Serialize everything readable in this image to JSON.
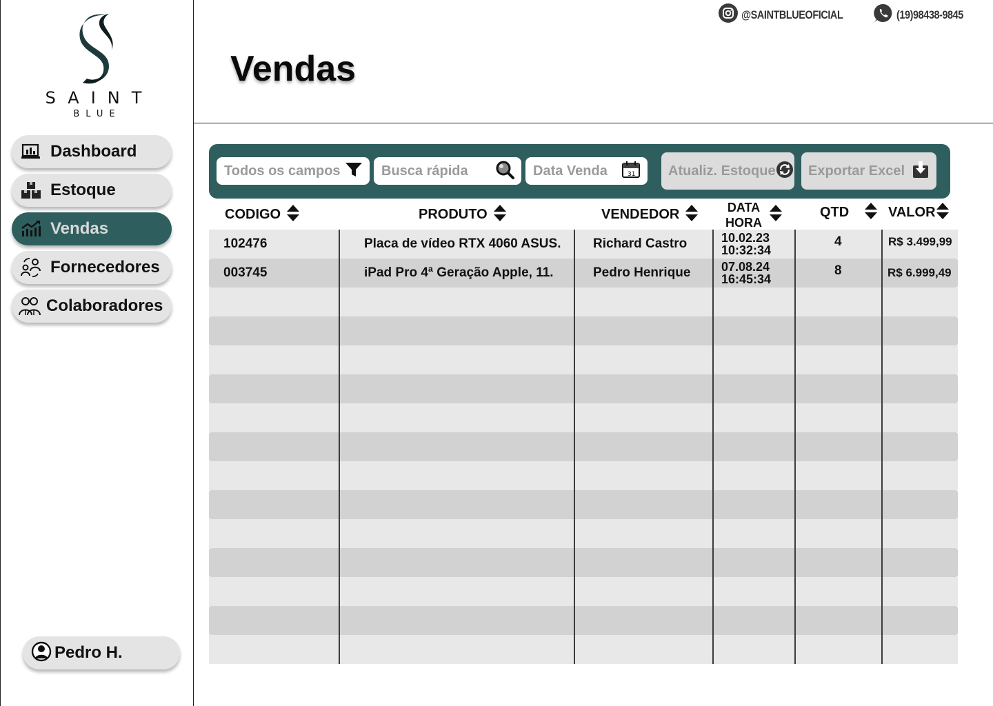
{
  "brand": {
    "name": "SAINT",
    "sub": "BLUE"
  },
  "nav": [
    {
      "label": "Dashboard",
      "icon": "dashboard-icon",
      "active": false
    },
    {
      "label": "Estoque",
      "icon": "boxes-icon",
      "active": false
    },
    {
      "label": "Vendas",
      "icon": "sales-chart-icon",
      "active": true
    },
    {
      "label": "Fornecedores",
      "icon": "suppliers-icon",
      "active": false
    },
    {
      "label": "Colaboradores",
      "icon": "team-icon",
      "active": false
    }
  ],
  "user": {
    "name": "Pedro H."
  },
  "social": {
    "instagram": "@SAINTBLUEOFICIAL",
    "whatsapp": "(19)98438-9845"
  },
  "page": {
    "title": "Vendas"
  },
  "toolbar": {
    "filter_placeholder": "Todos os campos",
    "search_placeholder": "Busca rápida",
    "date_placeholder": "Data Venda",
    "update_stock_label": "Atualiz. Estoque",
    "export_label": "Exportar Excel"
  },
  "table": {
    "headers": {
      "codigo": "CODIGO",
      "produto": "PRODUTO",
      "vendedor": "VENDEDOR",
      "data": "DATA",
      "hora": "HORA",
      "qtd": "QTD",
      "valor": "VALOR"
    },
    "rows": [
      {
        "codigo": "102476",
        "produto": "Placa de vídeo RTX 4060 ASUS.",
        "vendedor": "Richard Castro",
        "data": "10.02.23",
        "hora": "10:32:34",
        "qtd": "4",
        "valor": "R$ 3.499,99"
      },
      {
        "codigo": "003745",
        "produto": "iPad Pro 4ª Geração Apple, 11.",
        "vendedor": "Pedro Henrique",
        "data": "07.08.24",
        "hora": "16:45:34",
        "qtd": "8",
        "valor": "R$ 6.999,49"
      }
    ],
    "empty_rows": 13
  },
  "colors": {
    "accent": "#2f5e5f",
    "row_light": "#e8e8e8",
    "row_dark": "#d2d2d2",
    "chip": "#e4e4e4"
  }
}
